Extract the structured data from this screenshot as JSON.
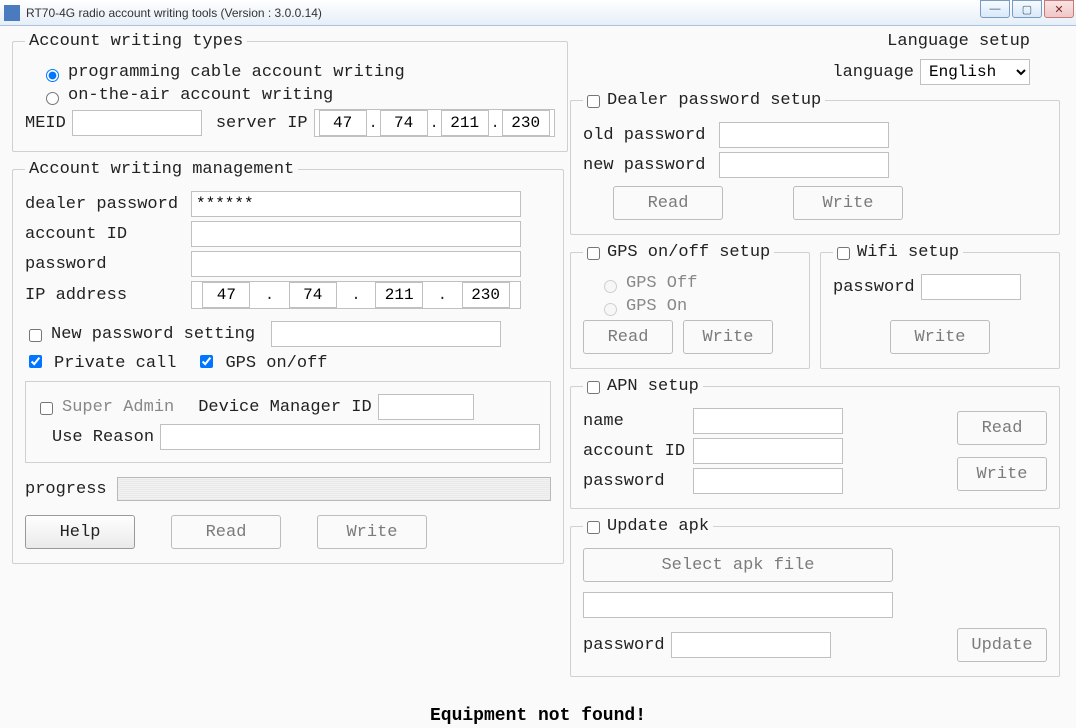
{
  "window": {
    "title": "RT70-4G radio account writing tools (Version : 3.0.0.14)"
  },
  "types": {
    "legend": "Account writing types",
    "opt_cable": "programming cable account writing",
    "opt_ota": "on-the-air account writing",
    "selected": "cable",
    "meid_label": "MEID",
    "meid_value": "",
    "server_ip_label": "server IP",
    "server_ip": [
      "47",
      "74",
      "211",
      "230"
    ]
  },
  "mgmt": {
    "legend": "Account writing management",
    "dealer_pwd_label": "dealer password",
    "dealer_pwd_value": "******",
    "account_id_label": "account ID",
    "account_id_value": "",
    "password_label": "password",
    "password_value": "",
    "ip_label": "IP address",
    "ip": [
      "47",
      "74",
      "211",
      "230"
    ],
    "new_pwd_check_label": "New password setting",
    "new_pwd_checked": false,
    "new_pwd_value": "",
    "private_call_label": "Private call",
    "private_call_checked": true,
    "gps_toggle_label": "GPS on/off",
    "gps_toggle_checked": true,
    "super_admin_label": "Super Admin",
    "super_admin_checked": false,
    "device_mgr_label": "Device Manager ID",
    "device_mgr_value": "",
    "use_reason_label": "Use Reason",
    "use_reason_value": "",
    "progress_label": "progress",
    "help_btn": "Help",
    "read_btn": "Read",
    "write_btn": "Write"
  },
  "lang": {
    "title": "Language setup",
    "label": "language",
    "value": "English"
  },
  "dealer_setup": {
    "legend": "Dealer password setup",
    "enabled": false,
    "old_label": "old password",
    "old_value": "",
    "new_label": "new password",
    "new_value": "",
    "read_btn": "Read",
    "write_btn": "Write"
  },
  "gps": {
    "legend": "GPS on/off setup",
    "enabled": false,
    "off_label": "GPS Off",
    "on_label": "GPS On",
    "selected": "",
    "read_btn": "Read",
    "write_btn": "Write"
  },
  "wifi": {
    "legend": "Wifi setup",
    "enabled": false,
    "pwd_label": "password",
    "pwd_value": "",
    "write_btn": "Write"
  },
  "apn": {
    "legend": "APN setup",
    "enabled": false,
    "name_label": "name",
    "name_value": "",
    "account_label": "account ID",
    "account_value": "",
    "pwd_label": "password",
    "pwd_value": "",
    "read_btn": "Read",
    "write_btn": "Write"
  },
  "apk": {
    "legend": "Update apk",
    "enabled": false,
    "select_btn": "Select apk file",
    "file_value": "",
    "pwd_label": "password",
    "pwd_value": "",
    "update_btn": "Update"
  },
  "status": "Equipment not found!"
}
